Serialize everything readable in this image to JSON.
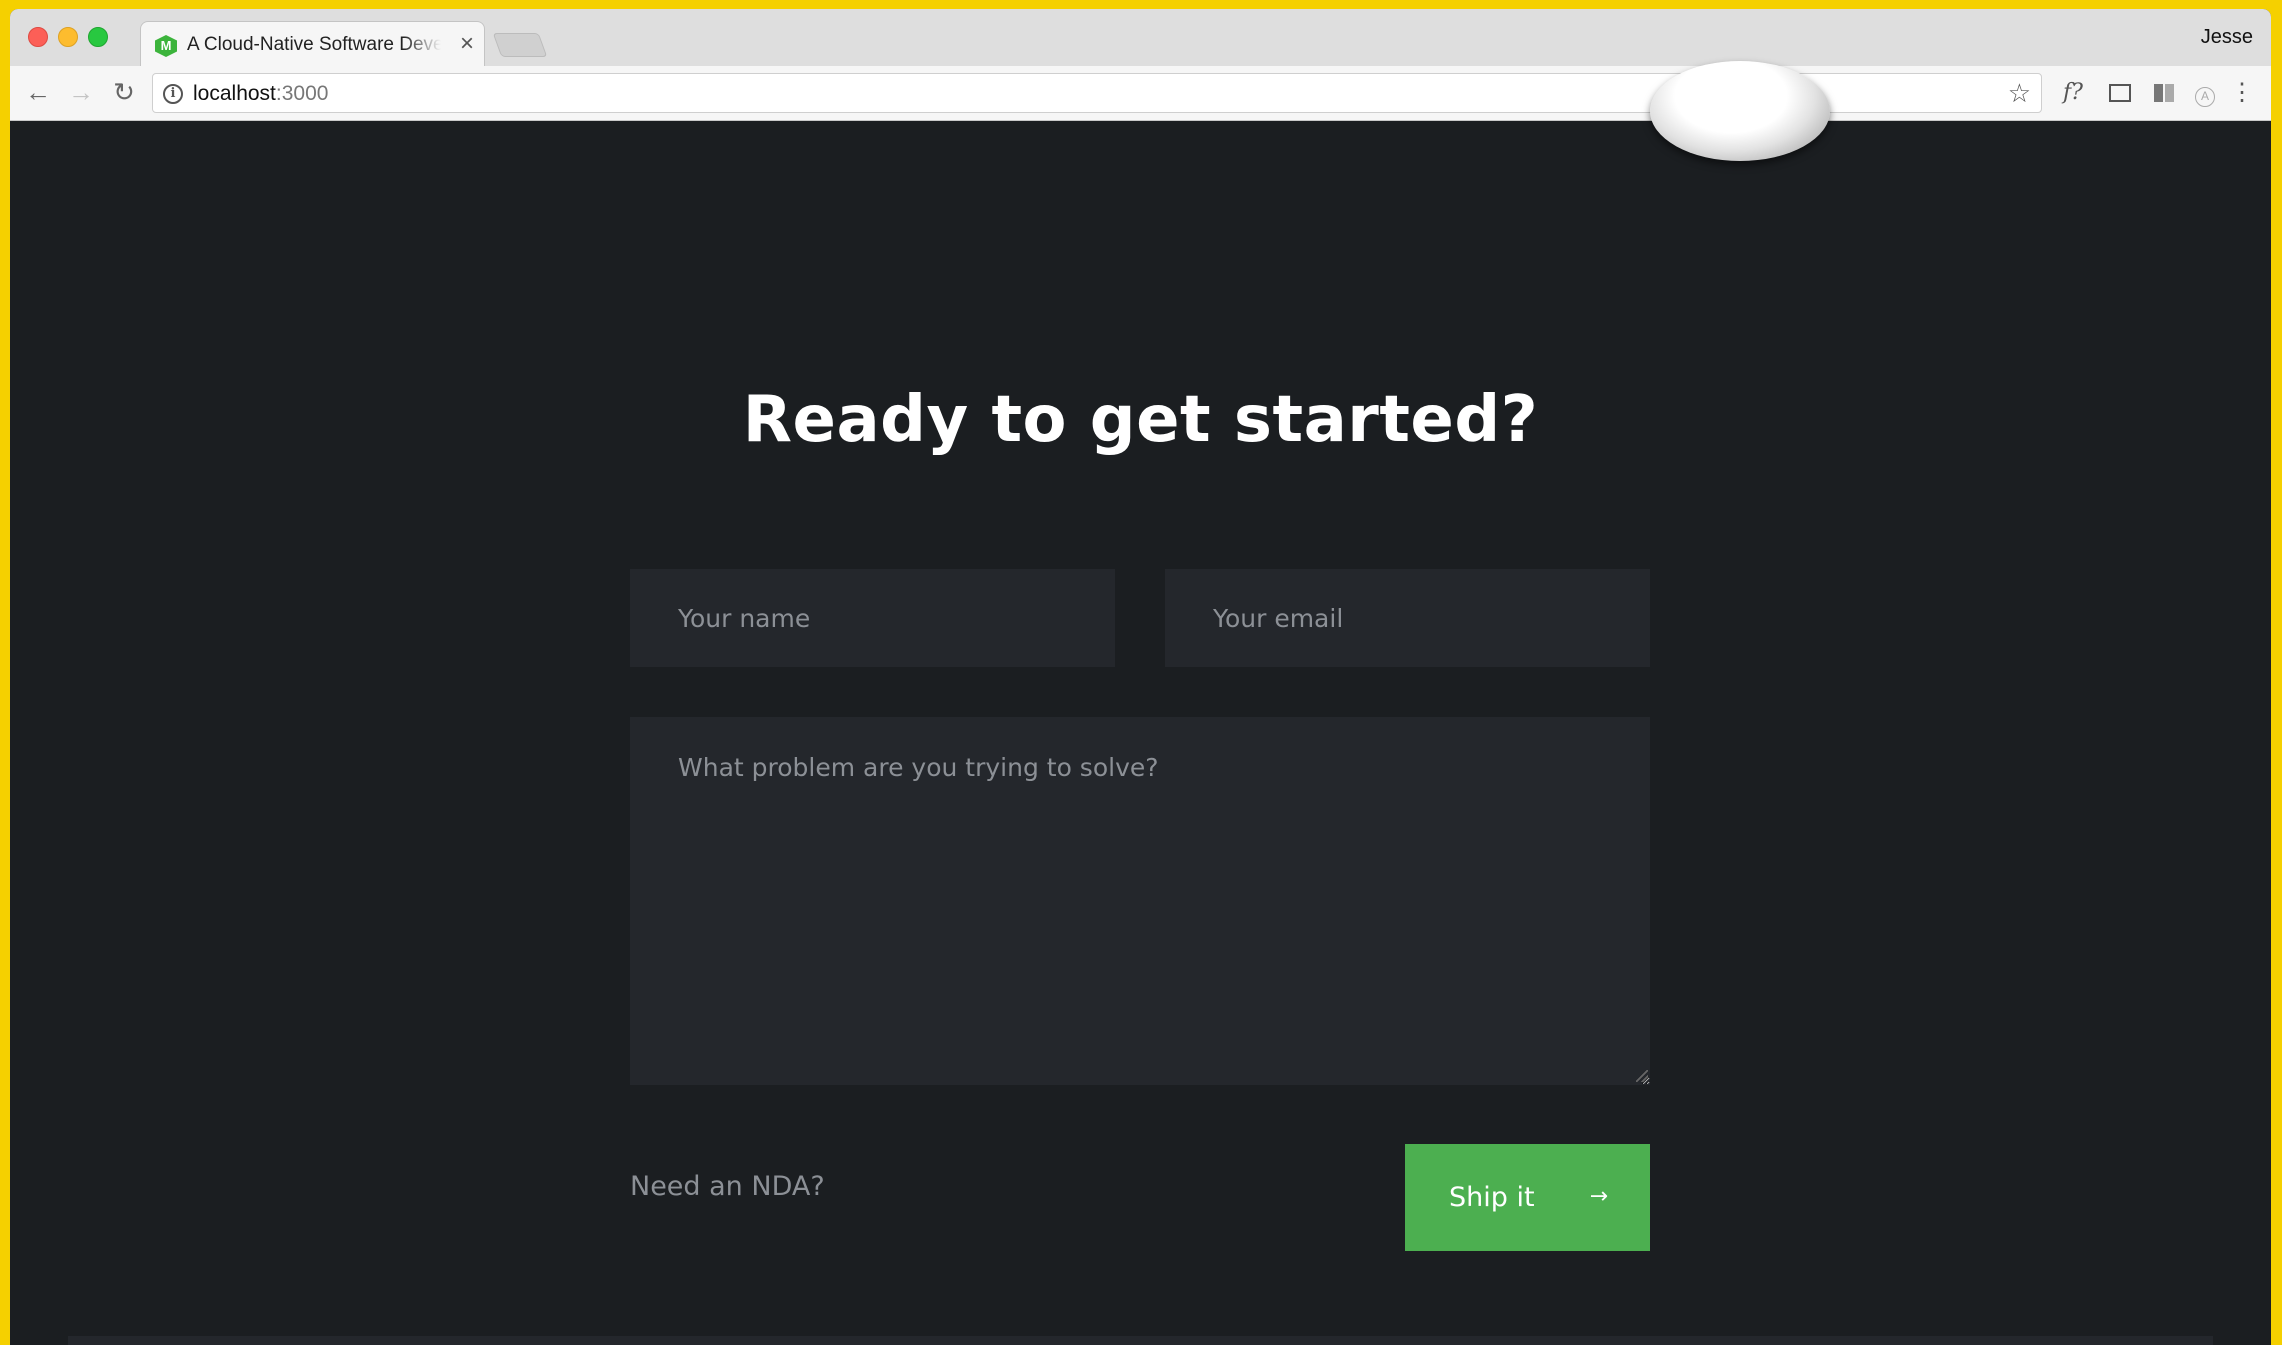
{
  "browser": {
    "tab_title": "A Cloud-Native Software Development",
    "tab_favicon_letter": "M",
    "tab_close": "×",
    "profile_name": "Jesse",
    "url_host": "localhost",
    "url_port": ":3000",
    "icons": {
      "back": "arrow-left-icon",
      "forward": "arrow-right-icon",
      "reload": "reload-icon",
      "info": "info-icon",
      "star": "star-icon",
      "fonts_ext": "f?",
      "menu": "⋮"
    }
  },
  "page": {
    "headline": "Ready to get started?",
    "name_placeholder": "Your name",
    "email_placeholder": "Your email",
    "problem_placeholder": "What problem are you trying to solve?",
    "nda_label": "Need an NDA?",
    "submit_label": "Ship it",
    "submit_arrow": "→"
  },
  "colors": {
    "page_background": "#1b1e21",
    "field_background": "#24272c",
    "accent_green": "#4caf50",
    "frame_yellow": "#f5d000"
  }
}
